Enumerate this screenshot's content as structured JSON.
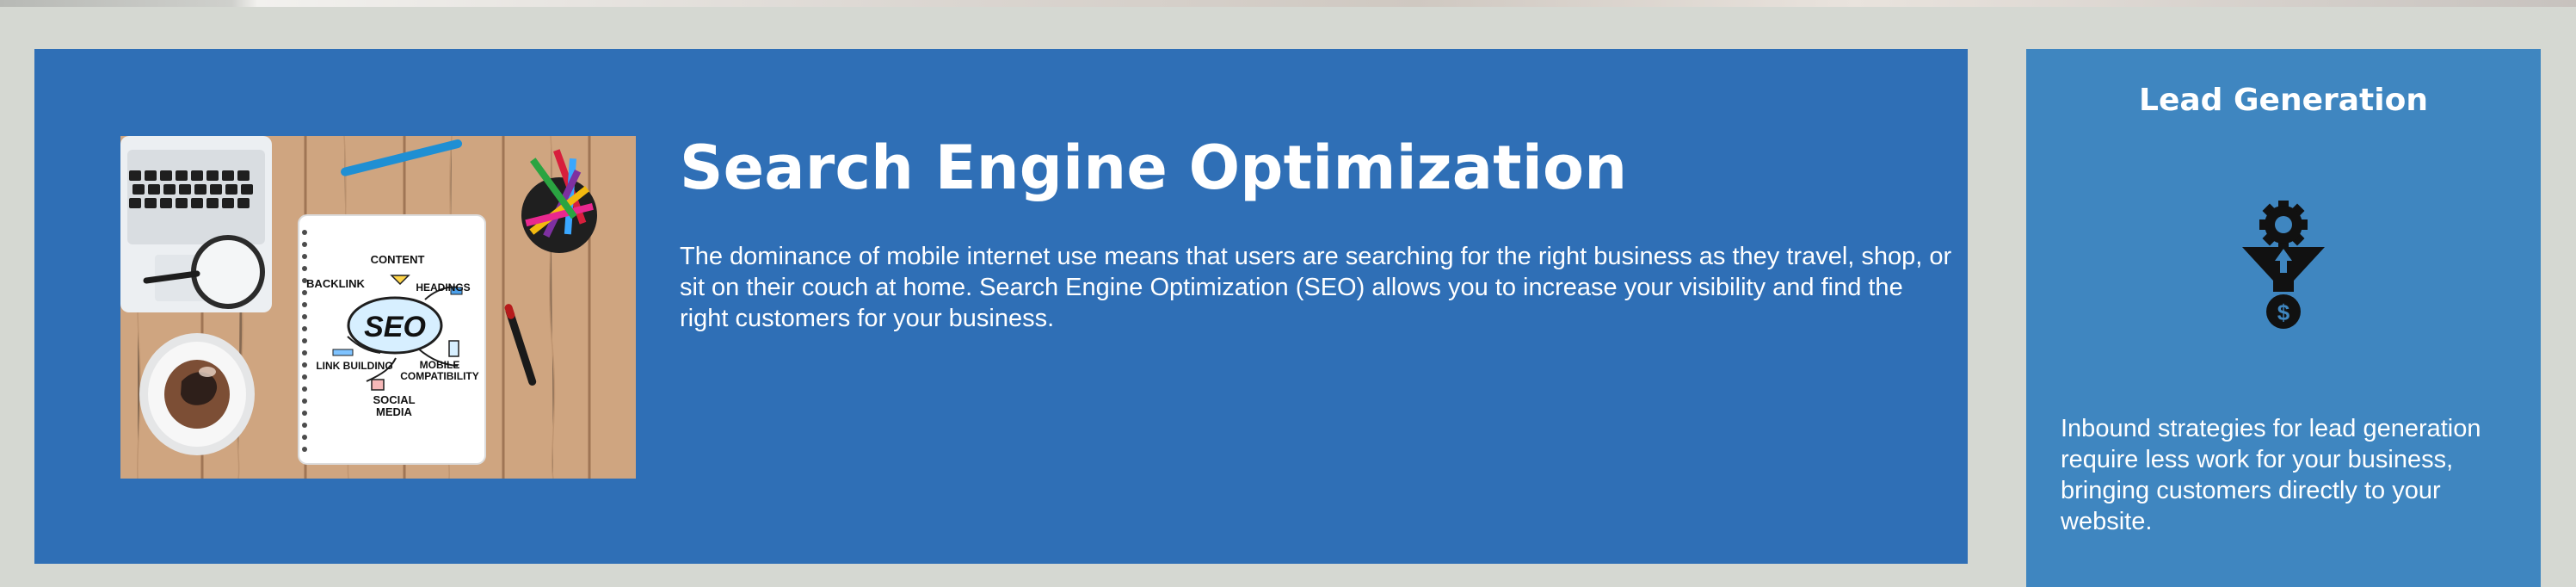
{
  "top_banner": {
    "name": "hero-image-strip"
  },
  "main_section": {
    "title": "Search Engine Optimization",
    "description": "The dominance of mobile internet use means that users are searching for the right business as they travel, shop, or sit on their couch at home. Search Engine Optimization (SEO) allows you to increase your visibility and find the right customers for your business.",
    "image": {
      "center_label": "SEO",
      "labels": [
        "CONTENT",
        "BACKLINK",
        "HEADINGS",
        "LINK BUILDING",
        "MOBILE",
        "COMPATIBILITY",
        "SOCIAL",
        "MEDIA"
      ]
    }
  },
  "lead_card": {
    "title": "Lead Generation",
    "icon": "gear-funnel-dollar-icon",
    "description": "Inbound strategies for lead generation require less work for your business, bringing customers directly to your website."
  },
  "colors": {
    "page_background": "#d5d8d2",
    "main_panel": "#2f6fb6",
    "lead_card": "#3f86c0",
    "text": "#ffffff",
    "icon": "#111111"
  }
}
